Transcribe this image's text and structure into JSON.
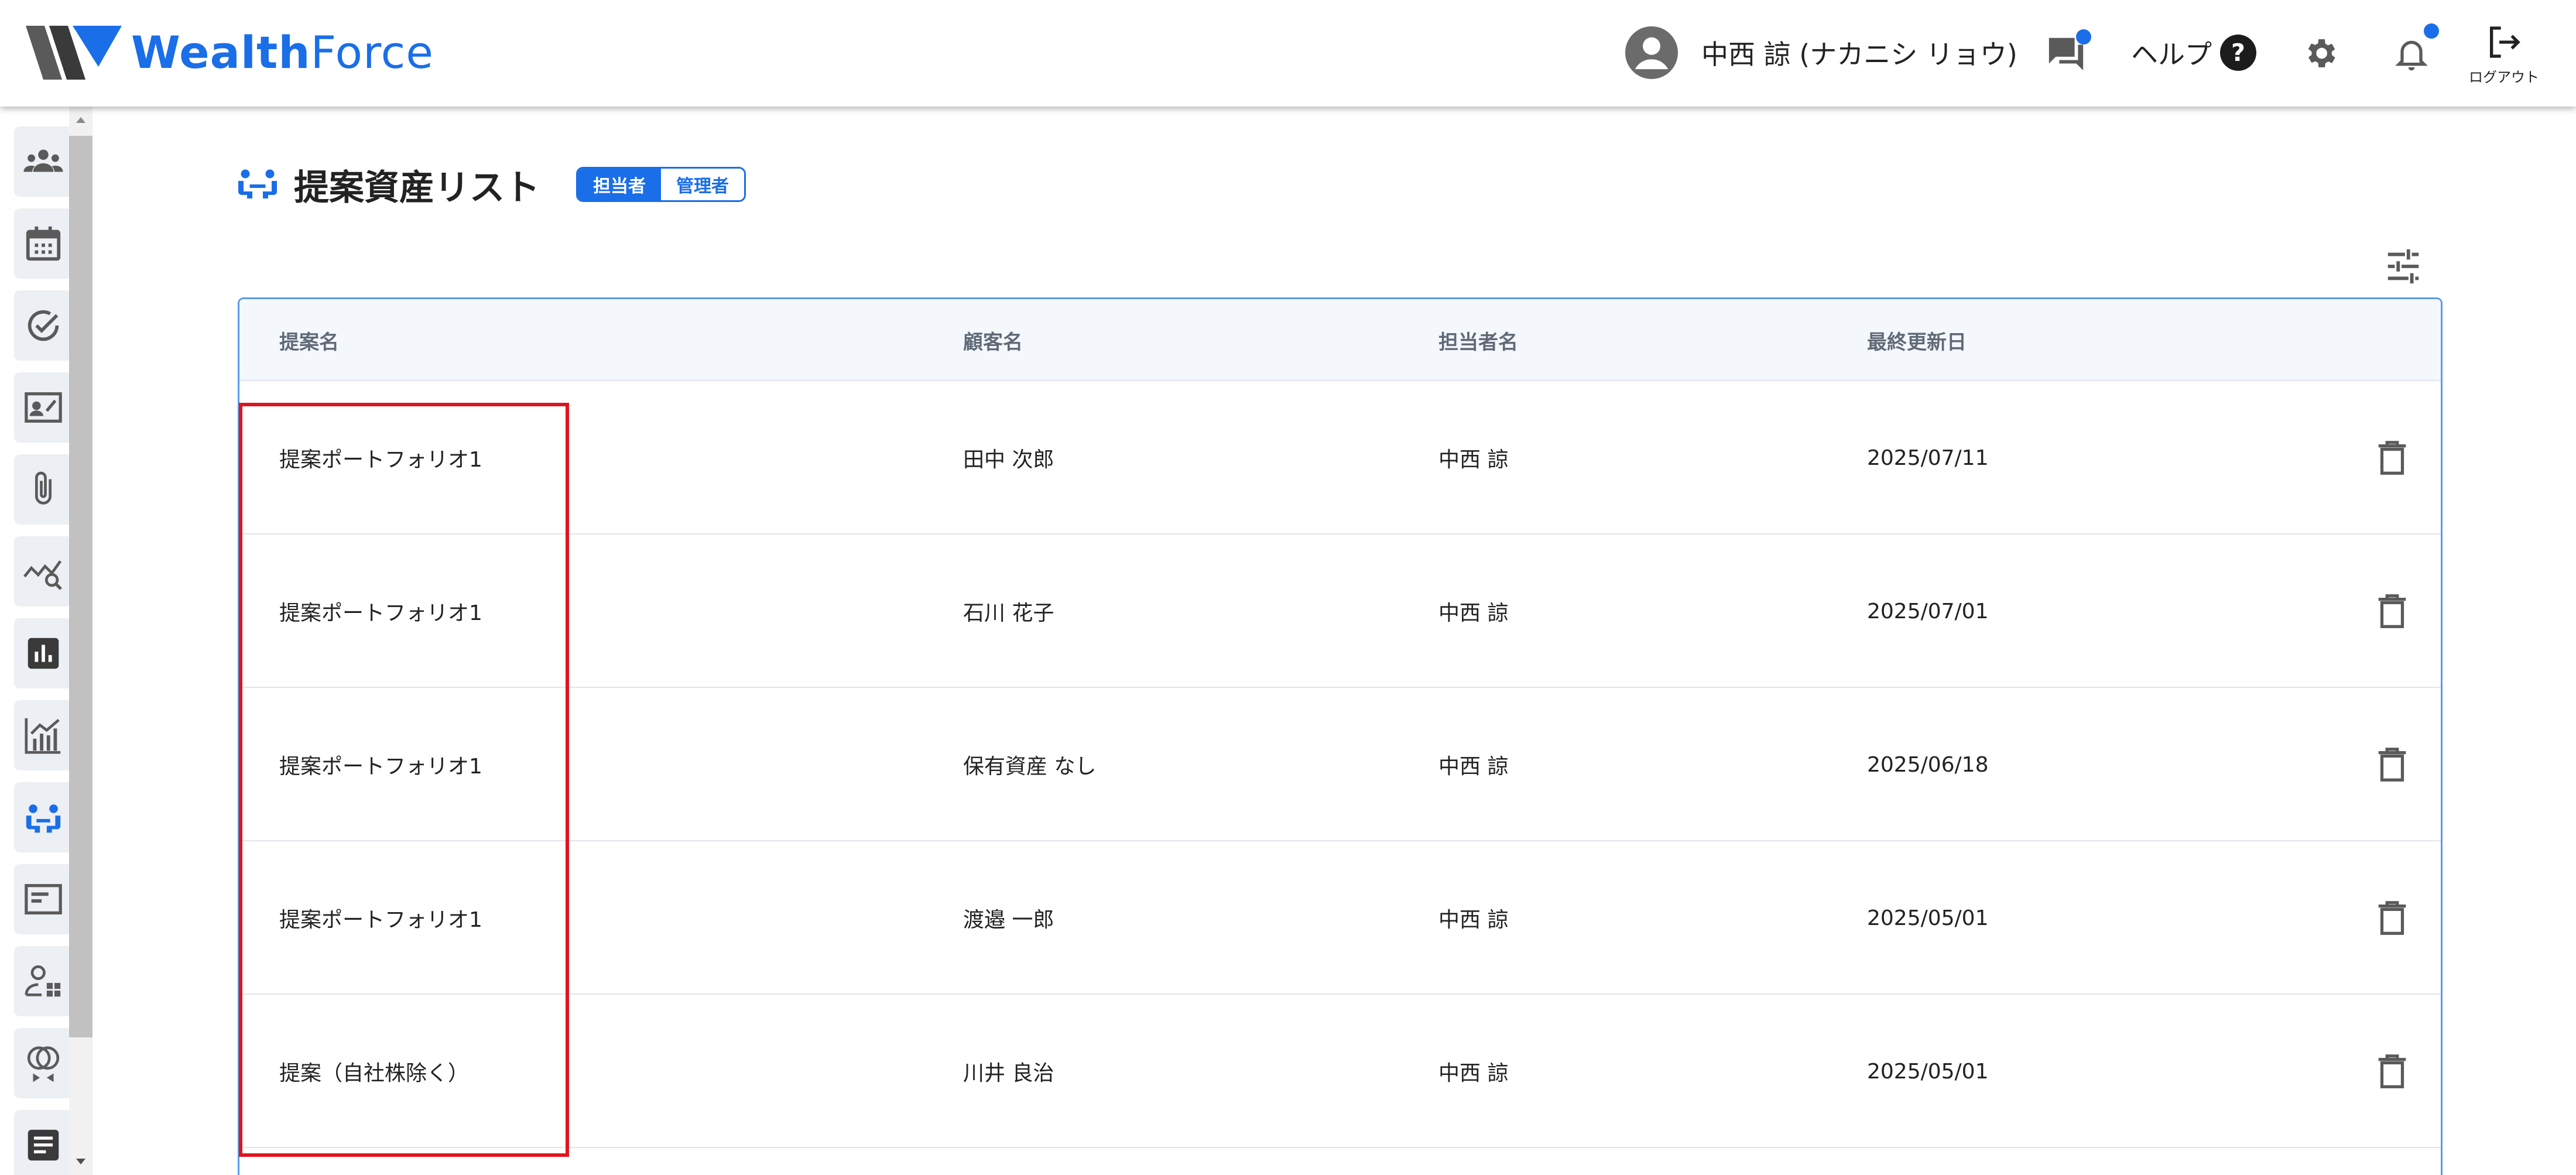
{
  "brand": {
    "name_bold": "Wealth",
    "name_light": "Force",
    "accent": "#1a6ee8"
  },
  "header": {
    "user_name": "中西 諒 (ナカニシ リョウ)",
    "help_label": "ヘルプ",
    "logout_label": "ログアウト",
    "icons": [
      "account-circle-icon",
      "chat-icon",
      "help-icon",
      "gear-icon",
      "bell-icon",
      "logout-icon"
    ]
  },
  "sidebar": {
    "items": [
      {
        "icon": "people-icon"
      },
      {
        "icon": "calendar-icon"
      },
      {
        "icon": "check-circle-icon"
      },
      {
        "icon": "contact-card-icon"
      },
      {
        "icon": "paperclip-icon"
      },
      {
        "icon": "chart-search-icon"
      },
      {
        "icon": "bar-chart-icon"
      },
      {
        "icon": "growth-chart-icon"
      },
      {
        "icon": "meeting-icon",
        "active": true
      },
      {
        "icon": "list-card-icon"
      },
      {
        "icon": "person-grid-icon"
      },
      {
        "icon": "link-rings-icon"
      },
      {
        "icon": "document-icon"
      }
    ]
  },
  "page": {
    "title": "提案資産リスト",
    "role_toggle": {
      "options": [
        "担当者",
        "管理者"
      ],
      "selected": "担当者"
    }
  },
  "table": {
    "columns": [
      "提案名",
      "顧客名",
      "担当者名",
      "最終更新日"
    ],
    "rows": [
      {
        "proposal": "提案ポートフォリオ1",
        "customer": "田中 次郎",
        "owner": "中西 諒",
        "updated": "2025/07/11"
      },
      {
        "proposal": "提案ポートフォリオ1",
        "customer": "石川 花子",
        "owner": "中西 諒",
        "updated": "2025/07/01"
      },
      {
        "proposal": "提案ポートフォリオ1",
        "customer": "保有資産 なし",
        "owner": "中西 諒",
        "updated": "2025/06/18"
      },
      {
        "proposal": "提案ポートフォリオ1",
        "customer": "渡邉 一郎",
        "owner": "中西 諒",
        "updated": "2025/05/01"
      },
      {
        "proposal": "提案（自社株除く）",
        "customer": "川井 良治",
        "owner": "中西 諒",
        "updated": "2025/05/01"
      }
    ]
  },
  "colors": {
    "highlight": "#e0141e",
    "table_border": "#5b9be8",
    "header_bg": "#f4f8fd"
  }
}
